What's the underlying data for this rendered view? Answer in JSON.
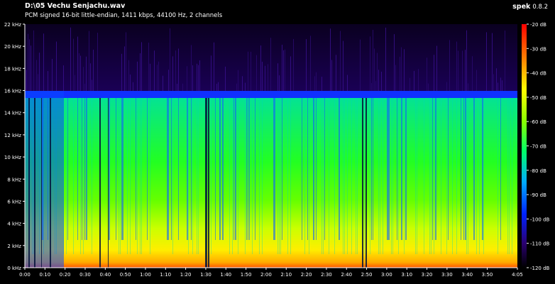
{
  "header": {
    "file_title": "D:\\05 Vechu Senjachu.wav",
    "file_info": "PCM signed 16-bit little-endian, 1411 kbps, 44100 Hz, 2 channels",
    "app_name": "spek",
    "app_version": "0.8.2"
  },
  "y_axis_labels": [
    "22 kHz",
    "20 kHz",
    "18 kHz",
    "16 kHz",
    "14 kHz",
    "12 kHz",
    "10 kHz",
    "8 kHz",
    "6 kHz",
    "4 kHz",
    "2 kHz",
    "0 kHz"
  ],
  "x_axis_labels": [
    "0:00",
    "0:10",
    "0:20",
    "0:30",
    "0:40",
    "0:50",
    "1:00",
    "1:10",
    "1:20",
    "1:30",
    "1:40",
    "1:50",
    "2:00",
    "2:10",
    "2:20",
    "2:30",
    "2:40",
    "2:50",
    "3:00",
    "3:10",
    "3:20",
    "3:30",
    "3:40",
    "3:50",
    "4:05"
  ],
  "db_scale_labels": [
    "-20 dB",
    "-30 dB",
    "-40 dB",
    "-50 dB",
    "-60 dB",
    "-70 dB",
    "-80 dB",
    "-90 dB",
    "-100 dB",
    "-110 dB",
    "-120 dB"
  ],
  "colors": {
    "background": "#000000",
    "db_gradient": [
      "#ff0000",
      "#ff8800",
      "#ffff00",
      "#88ff00",
      "#00ff66",
      "#00aaff",
      "#0022ff",
      "#2a0070",
      "#000000"
    ]
  }
}
